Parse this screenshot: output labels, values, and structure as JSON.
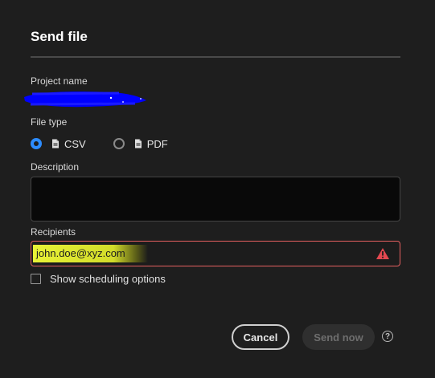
{
  "dialog": {
    "title": "Send file"
  },
  "project": {
    "label": "Project name",
    "value_redacted": true
  },
  "file_type": {
    "label": "File type",
    "options": [
      {
        "label": "CSV",
        "selected": true,
        "icon": "document-icon"
      },
      {
        "label": "PDF",
        "selected": false,
        "icon": "document-icon"
      }
    ]
  },
  "description": {
    "label": "Description",
    "value": ""
  },
  "recipients": {
    "label": "Recipients",
    "value": "john.doe@xyz.com",
    "error_icon": "warning-icon"
  },
  "scheduling": {
    "label": "Show scheduling options",
    "checked": false
  },
  "actions": {
    "cancel_label": "Cancel",
    "send_label": "Send now",
    "help_icon": "help-icon",
    "help_glyph": "?"
  },
  "colors": {
    "background": "#1e1e1e",
    "accent": "#2d8cff",
    "error": "#e35f5f",
    "highlight": "#e9f236",
    "redaction": "#0000ff"
  }
}
